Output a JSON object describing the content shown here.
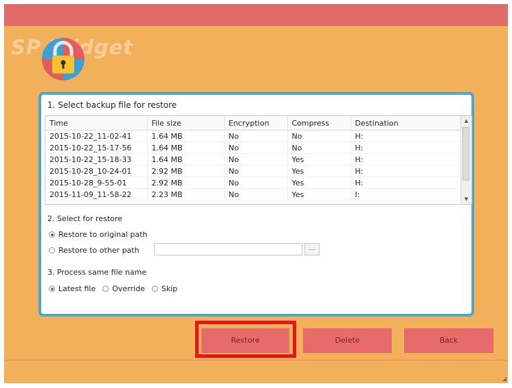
{
  "app": {
    "logo_text": "SP        Widget"
  },
  "section1": {
    "title": "1. Select backup file for restore",
    "columns": [
      "Time",
      "File size",
      "Encryption",
      "Compress",
      "Destination"
    ],
    "rows": [
      [
        "2015-10-22_11-02-41",
        "1.64 MB",
        "No",
        "No",
        "H:"
      ],
      [
        "2015-10-22_15-17-56",
        "1.64 MB",
        "No",
        "No",
        "H:"
      ],
      [
        "2015-10-22_15-18-33",
        "1.64 MB",
        "No",
        "Yes",
        "H:"
      ],
      [
        "2015-10-28_10-24-01",
        "2.92 MB",
        "No",
        "Yes",
        "H:"
      ],
      [
        "2015-10-28_9-55-01",
        "2.92 MB",
        "No",
        "Yes",
        "H:"
      ],
      [
        "2015-11-09_11-58-22",
        "2.23 MB",
        "No",
        "Yes",
        "I:"
      ]
    ]
  },
  "section2": {
    "title": "2. Select for restore",
    "option_original": "Restore to original path",
    "option_other": "Restore to other path",
    "other_path_value": "",
    "browse_label": "..."
  },
  "section3": {
    "title": "3. Process same file name",
    "option_latest": "Latest file",
    "option_override": "Override",
    "option_skip": "Skip"
  },
  "buttons": {
    "restore": "Restore",
    "delete": "Delete",
    "back": "Back"
  },
  "colors": {
    "background": "#f3b05a",
    "topbar": "#e06b68",
    "panel_border": "#4aa8c8",
    "button": "#e66b6a",
    "highlight": "#e8141a"
  }
}
